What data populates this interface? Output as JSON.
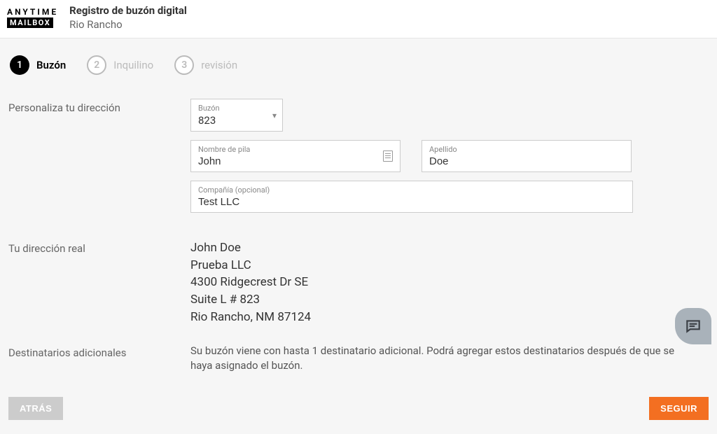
{
  "logo": {
    "top": "ANYTIME",
    "bottom": "MAILBOX"
  },
  "header": {
    "title": "Registro de buzón digital",
    "subtitle": "Rio Rancho"
  },
  "steps": [
    {
      "num": "1",
      "label": "Buzón",
      "active": true
    },
    {
      "num": "2",
      "label": "Inquilino",
      "active": false
    },
    {
      "num": "3",
      "label": "revisión",
      "active": false
    }
  ],
  "customize": {
    "section_label": "Personaliza tu dirección",
    "mailbox": {
      "label": "Buzón",
      "value": "823"
    },
    "first_name": {
      "label": "Nombre de pila",
      "value": "John"
    },
    "last_name": {
      "label": "Apellido",
      "value": "Doe"
    },
    "company": {
      "label": "Compañía (opcional)",
      "value": "Test LLC"
    }
  },
  "real_address": {
    "section_label": "Tu dirección real",
    "lines": {
      "name": "John Doe",
      "company": "Prueba LLC",
      "street": "4300 Ridgecrest Dr SE",
      "suite": "Suite L # 823",
      "city": "Rio Rancho, NM 87124"
    }
  },
  "recipients": {
    "section_label": "Destinatarios adicionales",
    "info": "Su buzón viene con hasta 1 destinatario adicional. Podrá agregar estos destinatarios después de que se haya asignado el buzón."
  },
  "actions": {
    "back": "ATRÁS",
    "next": "SEGUIR"
  }
}
